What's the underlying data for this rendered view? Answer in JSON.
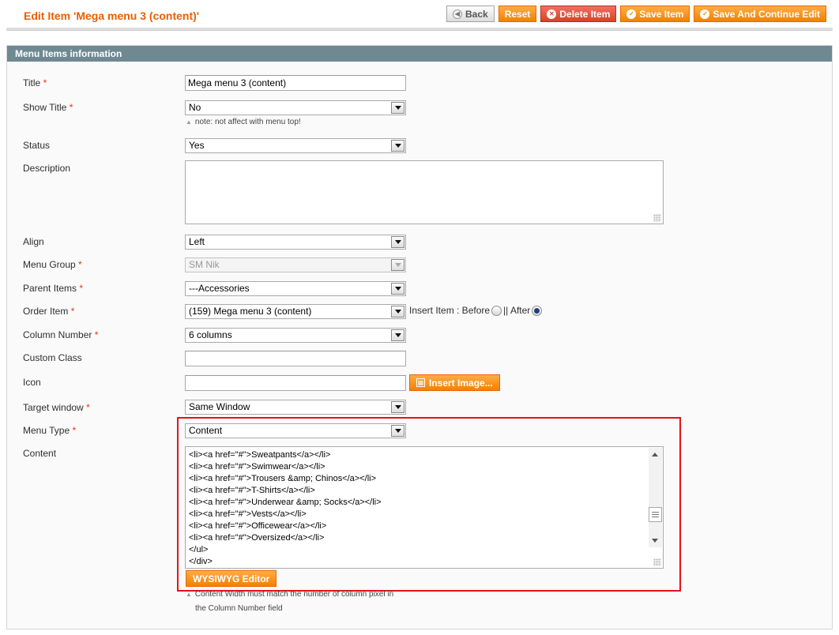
{
  "page": {
    "title": "Edit Item 'Mega menu 3 (content)'"
  },
  "toolbar": {
    "back": "Back",
    "reset": "Reset",
    "delete": "Delete Item",
    "save": "Save Item",
    "save_continue": "Save And Continue Edit"
  },
  "section": {
    "title": "Menu Items information"
  },
  "fields": {
    "title": {
      "label": "Title",
      "required": "*",
      "value": "Mega menu 3 (content)"
    },
    "show_title": {
      "label": "Show Title",
      "required": "*",
      "value": "No",
      "note": "note: not affect with menu top!"
    },
    "status": {
      "label": "Status",
      "value": "Yes"
    },
    "description": {
      "label": "Description",
      "value": ""
    },
    "align": {
      "label": "Align",
      "value": "Left"
    },
    "menu_group": {
      "label": "Menu Group",
      "required": "*",
      "value": "SM Nik"
    },
    "parent_items": {
      "label": "Parent Items",
      "required": "*",
      "value": "---Accessories"
    },
    "order_item": {
      "label": "Order Item",
      "required": "*",
      "value": "(159) Mega menu 3 (content)",
      "insert_label": "Insert Item : Before",
      "after_label": "|| After",
      "selected": "After"
    },
    "column_number": {
      "label": "Column Number",
      "required": "*",
      "value": "6 columns"
    },
    "custom_class": {
      "label": "Custom Class",
      "value": ""
    },
    "icon": {
      "label": "Icon",
      "value": "",
      "insert_button": "Insert Image..."
    },
    "target_window": {
      "label": "Target window",
      "required": "*",
      "value": "Same Window"
    },
    "menu_type": {
      "label": "Menu Type",
      "required": "*",
      "value": "Content"
    },
    "content": {
      "label": "Content",
      "lines": [
        "<li><a href=\"#\">Sweatpants</a></li>",
        "<li><a href=\"#\">Swimwear</a></li>",
        "<li><a href=\"#\">Trousers &amp; Chinos</a></li>",
        "<li><a href=\"#\">T-Shirts</a></li>",
        "<li><a href=\"#\">Underwear &amp; Socks</a></li>",
        "<li><a href=\"#\">Vests</a></li>",
        "<li><a href=\"#\">Officewear</a></li>",
        "<li><a href=\"#\">Oversized</a></li>",
        "</ul>",
        "</div>"
      ],
      "editor_button": "WYSIWYG Editor",
      "note_line1": "Content Width must match the number of column pixel in",
      "note_line2": "the Column Number field"
    }
  },
  "icons": {
    "back": "left-arrow-icon",
    "delete": "delete-icon",
    "save": "checkmark-icon",
    "insert_image": "image-icon",
    "note": "triangle-up-icon"
  },
  "colors": {
    "accent": "#eb5e00",
    "button": "#f18200",
    "section_header": "#6f8992",
    "highlight": "#e2131b",
    "required": "#eb340a"
  }
}
